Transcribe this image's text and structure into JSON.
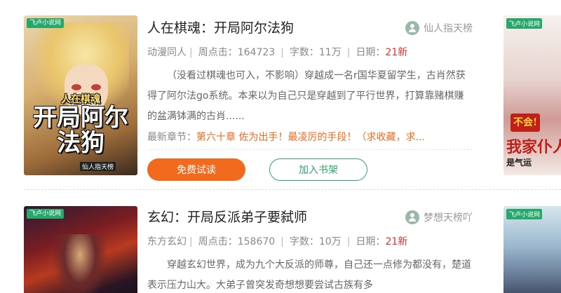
{
  "books": [
    {
      "title": "人在棋魂：开局阿尔法狗",
      "rank": "仙人指天榜",
      "category": "动漫同人",
      "clicks_label": "周点击：",
      "clicks": "164723",
      "words_label": "字数：",
      "words": "11万",
      "date_label": "日期：",
      "date_new": "21新",
      "description": "（没看过棋魂也可入，不影响）穿越成一名r国华夏留学生，古肖然获得了阿尔法go系统。本来以为自己只是穿越到了平行世界，打算靠赌棋赚的盆满钵满的古肖......",
      "latest_label": "最新章节：",
      "latest_chapter": "第六十章 佐为出手！最凌厉的手段！（求收藏，求...",
      "read_button": "免费试读",
      "shelf_button": "加入书架",
      "cover": {
        "badge": "飞卢小说网",
        "art_top": "人在棋魂",
        "art_main": "开局阿尔法狗",
        "art_author": "仙人指天榜"
      },
      "side_cover": {
        "badge": "飞卢小说网",
        "t1": "不会!",
        "t2": "我家仆人",
        "t3": "是气运"
      }
    },
    {
      "title": "玄幻：开局反派弟子要弑师",
      "rank": "梦想天榜吖",
      "category": "东方玄幻",
      "clicks_label": "周点击：",
      "clicks": "158670",
      "words_label": "字数：",
      "words": "10万",
      "date_label": "日期：",
      "date_new": "21新",
      "description": "穿越玄幻世界，成为九个大反派的师尊，自己还一点修为都没有，楚道表示压力山大。大弟子曾突发奇想想要尝试古族有多",
      "cover": {
        "badge": "飞卢小说网"
      },
      "side_cover": {
        "badge": "飞卢小说网"
      }
    }
  ],
  "colors": {
    "accent_orange": "#f26a1e",
    "accent_green": "#2fa66b",
    "new_red": "#e23030"
  }
}
